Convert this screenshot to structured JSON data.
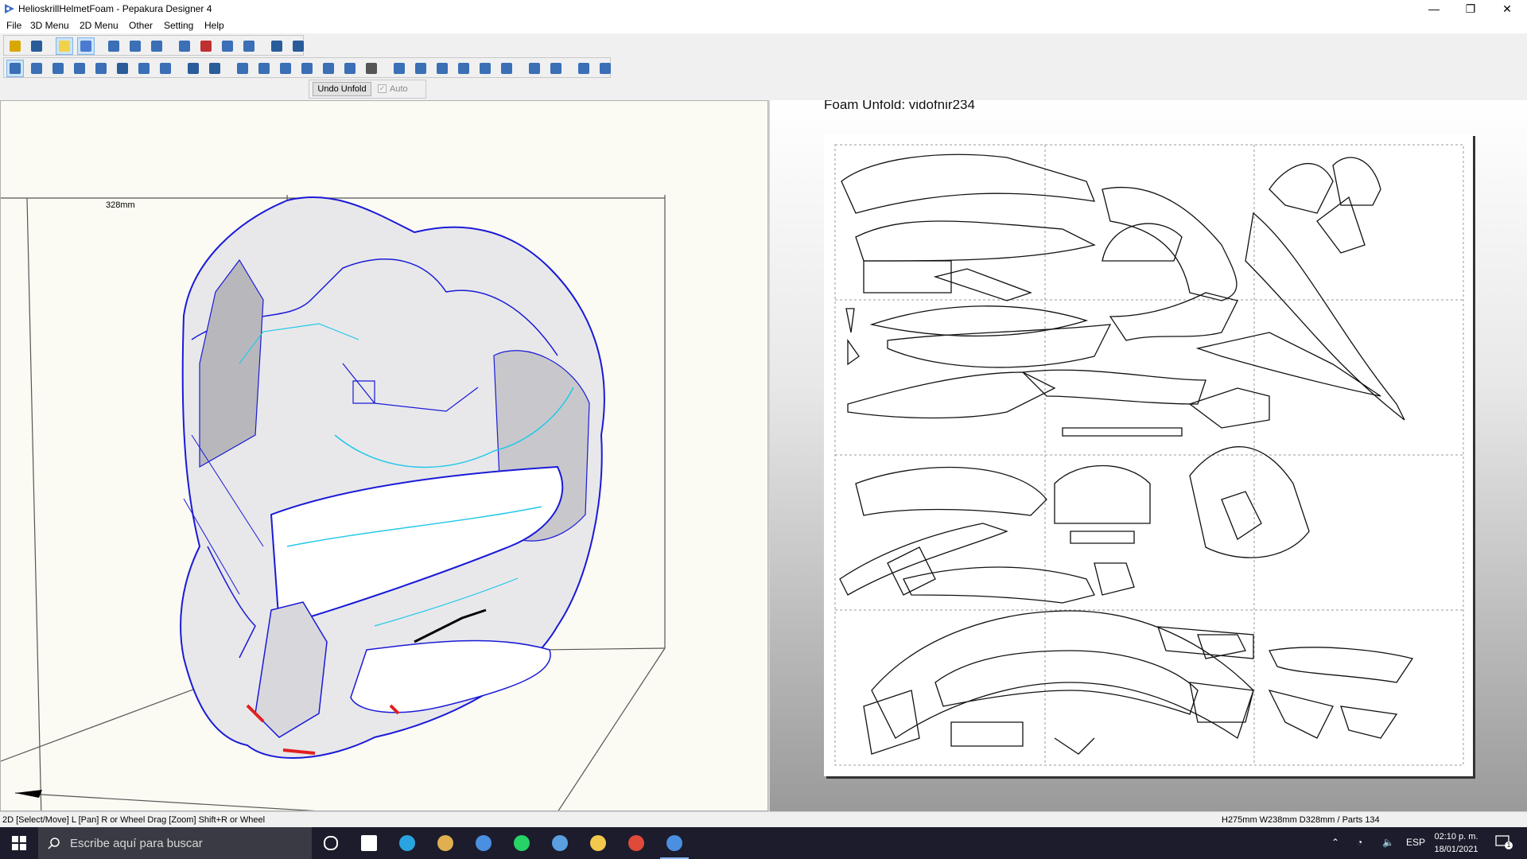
{
  "window": {
    "title": "HelioskrillHelmetFoam - Pepakura Designer 4",
    "controls": [
      "—",
      "❐",
      "✕"
    ]
  },
  "menu": [
    "File",
    "3D Menu",
    "2D Menu",
    "Other",
    "Setting",
    "Help"
  ],
  "toolbar1": [
    {
      "icon": "open-icon",
      "color": "#d9a800"
    },
    {
      "icon": "save-icon",
      "color": "#2a5c9a"
    },
    {
      "icon": "light-icon",
      "color": "#f2d14b",
      "active": true
    },
    {
      "icon": "texture-icon",
      "color": "#4a7bd0",
      "active": true
    },
    {
      "icon": "rotate-icon",
      "color": "#3b6fb6"
    },
    {
      "icon": "unfold-icon",
      "color": "#3b6fb6"
    },
    {
      "icon": "model-icon",
      "color": "#3b6fb6"
    },
    {
      "icon": "cylinder-icon",
      "color": "#3b6fb6"
    },
    {
      "icon": "axis-icon",
      "color": "#c03030"
    },
    {
      "icon": "mirror-icon",
      "color": "#3b6fb6"
    },
    {
      "icon": "link-icon",
      "color": "#3b6fb6"
    },
    {
      "icon": "split-view-icon",
      "color": "#2a5c9a"
    },
    {
      "icon": "single-view-icon",
      "color": "#2a5c9a"
    }
  ],
  "toolbar2": [
    {
      "icon": "select-move-icon",
      "color": "#3b6fb6",
      "active": true
    },
    {
      "icon": "rotate-part-icon",
      "color": "#3b6fb6"
    },
    {
      "icon": "join-icon",
      "color": "#3b6fb6"
    },
    {
      "icon": "edge-icon",
      "color": "#3b6fb6"
    },
    {
      "icon": "flap-icon",
      "color": "#3b6fb6"
    },
    {
      "icon": "text-icon",
      "color": "#2a5c9a"
    },
    {
      "icon": "image-icon",
      "color": "#3b6fb6"
    },
    {
      "icon": "box-icon",
      "color": "#3b6fb6"
    },
    {
      "icon": "undo-icon",
      "color": "#2a5c9a"
    },
    {
      "icon": "redo-icon",
      "color": "#2a5c9a"
    },
    {
      "icon": "book-icon",
      "color": "#3b6fb6"
    },
    {
      "icon": "scale-icon",
      "color": "#3b6fb6"
    },
    {
      "icon": "layout-icon",
      "color": "#3b6fb6"
    },
    {
      "icon": "page-icon",
      "color": "#3b6fb6"
    },
    {
      "icon": "export-icon",
      "color": "#3b6fb6"
    },
    {
      "icon": "preview-icon",
      "color": "#3b6fb6"
    },
    {
      "icon": "print-icon",
      "color": "#555555"
    },
    {
      "icon": "align-left-icon",
      "color": "#3b6fb6"
    },
    {
      "icon": "align-center-icon",
      "color": "#3b6fb6"
    },
    {
      "icon": "align-right-icon",
      "color": "#3b6fb6"
    },
    {
      "icon": "align-top-icon",
      "color": "#3b6fb6"
    },
    {
      "icon": "align-middle-icon",
      "color": "#3b6fb6"
    },
    {
      "icon": "align-bottom-icon",
      "color": "#3b6fb6"
    },
    {
      "icon": "distribute-h-icon",
      "color": "#3b6fb6"
    },
    {
      "icon": "distribute-v-icon",
      "color": "#3b6fb6"
    },
    {
      "icon": "fit-icon",
      "color": "#3b6fb6"
    },
    {
      "icon": "grid-icon",
      "color": "#3b6fb6"
    }
  ],
  "undo_bar": {
    "undo_label": "Undo Unfold",
    "auto_label": "Auto",
    "auto_check": "✓"
  },
  "view3d": {
    "dimension_label": "328mm"
  },
  "view2d": {
    "title": "Foam Unfold: vidofnir234"
  },
  "status": {
    "left": "2D [Select/Move] L [Pan] R or Wheel Drag [Zoom] Shift+R or Wheel",
    "right": "H275mm W238mm D328mm / Parts 134"
  },
  "taskbar": {
    "search_placeholder": "Escribe aquí para buscar",
    "apps": [
      {
        "icon": "cortana-icon",
        "color": "#ffffff"
      },
      {
        "icon": "task-view-icon",
        "color": "#ffffff"
      },
      {
        "icon": "skype-icon",
        "color": "#2aa4e0"
      },
      {
        "icon": "paint-icon",
        "color": "#e0b050"
      },
      {
        "icon": "pepakura-icon",
        "color": "#4a8fe0"
      },
      {
        "icon": "whatsapp-icon",
        "color": "#25d366"
      },
      {
        "icon": "installer-icon",
        "color": "#5aa0e0"
      },
      {
        "icon": "file-explorer-icon",
        "color": "#f2c94c"
      },
      {
        "icon": "chrome-icon",
        "color": "#e04a3a"
      },
      {
        "icon": "pepakura-active-icon",
        "color": "#4a8fe0"
      }
    ],
    "language": "ESP",
    "time": "02:10 p. m.",
    "date": "18/01/2021",
    "notification_count": "1"
  },
  "colors": {
    "mesh_edge": "#1a1ad8",
    "cut_edge": "#22c8e8",
    "highlight": "#e02020",
    "taskbar": "#1c1c2c"
  }
}
